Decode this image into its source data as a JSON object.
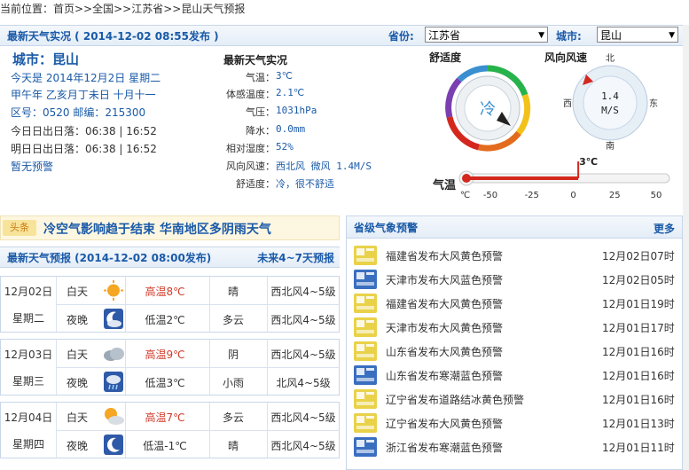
{
  "breadcrumb": {
    "text": "当前位置：首页>>全国>>江苏省>>昆山天气预报"
  },
  "topbar": {
    "title": "最新天气实况 ( 2014-12-02  08:55发布 )",
    "province_label": "省份:",
    "province_value": "江苏省",
    "city_label": "城市:",
    "city_value": "昆山"
  },
  "city_info": {
    "city": "城市：昆山",
    "today": "今天是  2014年12月2日  星期二",
    "lunar": "甲午年  乙亥月丁未日  十月十一",
    "codes": "区号：0520   邮编：215300",
    "today_sun": "今日日出日落：06:38  |  16:52",
    "tomorrow_sun": "明日日出日落：06:38  |  16:52",
    "warning": "暂无预警"
  },
  "observation": {
    "title": "最新天气实况",
    "items": [
      {
        "k": "气温：",
        "v": "3℃"
      },
      {
        "k": "体感温度：",
        "v": "2.1℃"
      },
      {
        "k": "气压：",
        "v": "1031hPa"
      },
      {
        "k": "降水：",
        "v": "0.0mm"
      },
      {
        "k": "相对湿度：",
        "v": "52%"
      },
      {
        "k": "风向风速：",
        "v": "西北风  微风  1.4M/S"
      },
      {
        "k": "舒适度：",
        "v": "冷，很不舒适"
      }
    ]
  },
  "comfort": {
    "title": "舒适度",
    "value": "冷"
  },
  "wind": {
    "title": "风向风速",
    "speed": "1.4",
    "unit": "M/S",
    "n": "北",
    "s": "南",
    "e": "东",
    "w": "西"
  },
  "thermo": {
    "label": "气温",
    "current": "3℃",
    "unit": "℃",
    "ticks": [
      "-50",
      "-25",
      "0",
      "25",
      "50"
    ],
    "value": 3
  },
  "headline": {
    "tag": "头条",
    "text": "冷空气影响趋于结束  华南地区多阴雨天气"
  },
  "forecast": {
    "title": "最新天气预报 (2014-12-02  08:00发布)",
    "future_link": "未来4~7天预报",
    "days": [
      {
        "date": "12月02日",
        "week": "星期二",
        "day": {
          "label": "白天",
          "icon": "sun-icon",
          "temp": "高温8℃",
          "weather": "晴",
          "wind": "西北风4~5级"
        },
        "night": {
          "label": "夜晚",
          "icon": "moon-cloud-icon",
          "temp": "低温2℃",
          "weather": "多云",
          "wind": "西北风4~5级"
        }
      },
      {
        "date": "12月03日",
        "week": "星期三",
        "day": {
          "label": "白天",
          "icon": "cloud-icon",
          "temp": "高温9℃",
          "weather": "阴",
          "wind": "西北风4~5级"
        },
        "night": {
          "label": "夜晚",
          "icon": "rain-icon",
          "temp": "低温3℃",
          "weather": "小雨",
          "wind": "北风4~5级"
        }
      },
      {
        "date": "12月04日",
        "week": "星期四",
        "day": {
          "label": "白天",
          "icon": "sun-cloud-icon",
          "temp": "高温7℃",
          "weather": "多云",
          "wind": "西北风4~5级"
        },
        "night": {
          "label": "夜晚",
          "icon": "moon-icon",
          "temp": "低温-1℃",
          "weather": "晴",
          "wind": "西北风4~5级"
        }
      }
    ]
  },
  "alerts": {
    "title": "省级气象预警",
    "more": "更多",
    "items": [
      {
        "text": "福建省发布大风黄色预警",
        "time": "12月02日07时",
        "color": "#e9d24a"
      },
      {
        "text": "天津市发布大风蓝色预警",
        "time": "12月02日05时",
        "color": "#3a6fc0"
      },
      {
        "text": "福建省发布大风黄色预警",
        "time": "12月01日19时",
        "color": "#e9d24a"
      },
      {
        "text": "天津市发布大风黄色预警",
        "time": "12月01日17时",
        "color": "#e9d24a"
      },
      {
        "text": "山东省发布大风黄色预警",
        "time": "12月01日16时",
        "color": "#e9d24a"
      },
      {
        "text": "山东省发布寒潮蓝色预警",
        "time": "12月01日16时",
        "color": "#3a6fc0"
      },
      {
        "text": "辽宁省发布道路结冰黄色预警",
        "time": "12月01日16时",
        "color": "#e9d24a"
      },
      {
        "text": "辽宁省发布大风黄色预警",
        "time": "12月01日13时",
        "color": "#e9d24a"
      },
      {
        "text": "浙江省发布寒潮蓝色预警",
        "time": "12月01日11时",
        "color": "#3a6fc0"
      }
    ]
  }
}
